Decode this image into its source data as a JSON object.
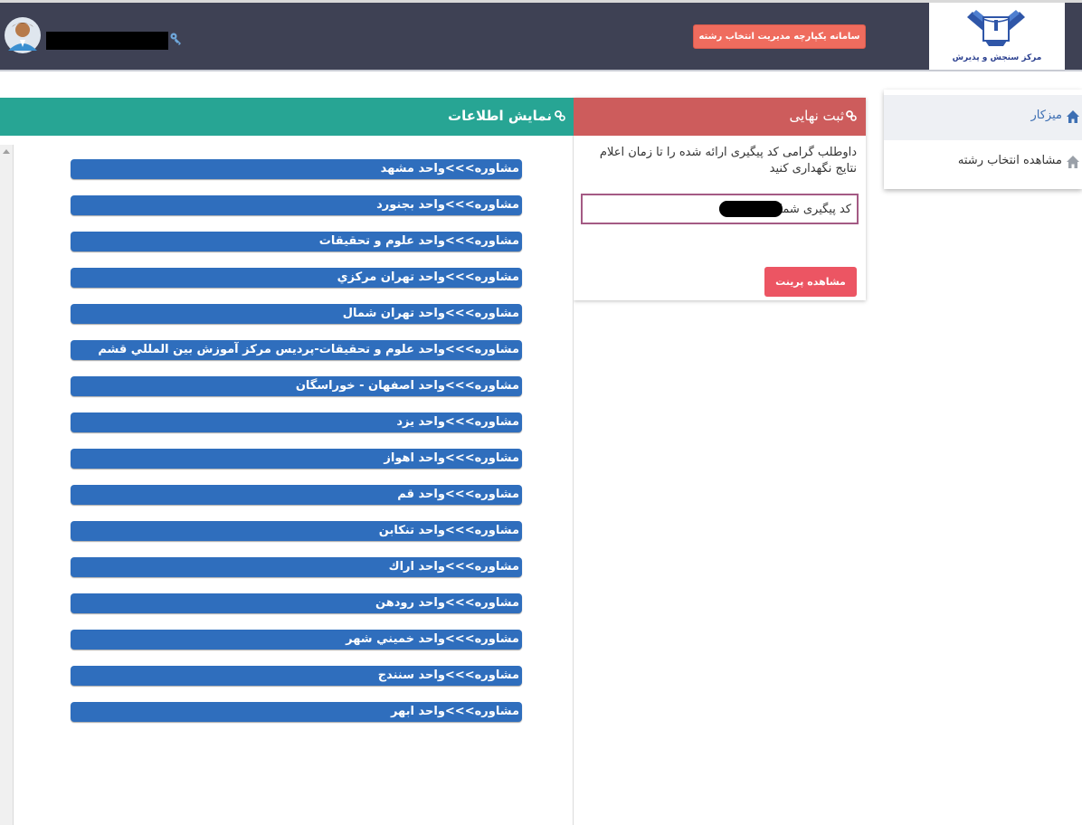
{
  "header": {
    "logo_text": "مرکز سنجش و پذیرش",
    "system_title": "سامانه یکپارچه مدیریت انتخاب رشته",
    "username": "████████",
    "colors": {
      "bar": "#3e4154",
      "title_button": "#ef6c5e"
    }
  },
  "sidebar": {
    "items": [
      {
        "label": "میزکار",
        "icon": "home-icon",
        "active": true
      },
      {
        "label": "مشاهده انتخاب رشته",
        "icon": "home-icon",
        "active": false
      }
    ]
  },
  "final_panel": {
    "title": "ثبت نهایی",
    "message": "داوطلب گرامی کد پیگیری ارائه شده را تا زمان اعلام نتایج نگهداری کنید",
    "tracking_label": "کد پیگیری شما",
    "tracking_code": "██████",
    "print_button": "مشاهده پرینت",
    "color": "#cd5c5c"
  },
  "info_panel": {
    "title": "نمایش اطلاعات",
    "color": "#27a594",
    "branches": [
      "مشاوره>>>واحد مشهد",
      "مشاوره>>>واحد بجنورد",
      "مشاوره>>>واحد علوم و تحقیقات",
      "مشاوره>>>واحد تهران مرکزي",
      "مشاوره>>>واحد تهران شمال",
      "مشاوره>>>واحد علوم و تحقیقات-پردیس مرکز آموزش بین المللي قشم",
      "مشاوره>>>واحد اصفهان - خوراسگان",
      "مشاوره>>>واحد یزد",
      "مشاوره>>>واحد اهواز",
      "مشاوره>>>واحد قم",
      "مشاوره>>>واحد تنکابن",
      "مشاوره>>>واحد اراك",
      "مشاوره>>>واحد رودهن",
      "مشاوره>>>واحد خميني شهر",
      "مشاوره>>>واحد سنندج",
      "مشاوره>>>واحد ابهر"
    ]
  }
}
